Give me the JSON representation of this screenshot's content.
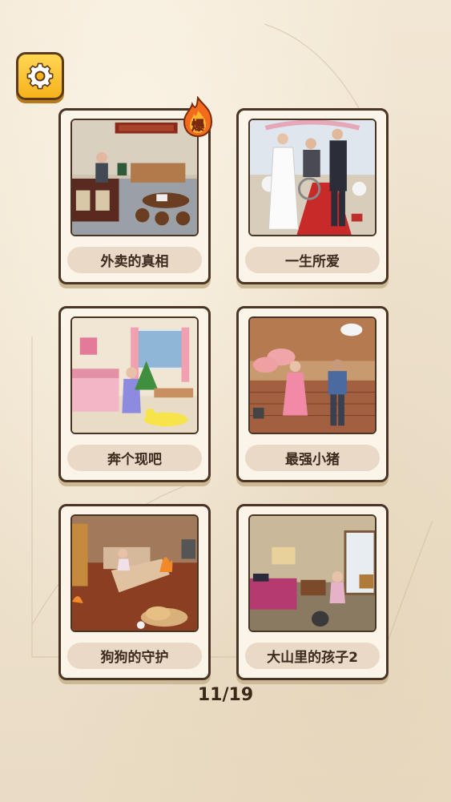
{
  "levels": [
    {
      "title": "外卖的真相",
      "badge": "爆"
    },
    {
      "title": "一生所爱"
    },
    {
      "title": "奔个现吧"
    },
    {
      "title": "最强小猪"
    },
    {
      "title": "狗狗的守护"
    },
    {
      "title": "大山里的孩子2"
    }
  ],
  "pager": {
    "text": "11/19"
  },
  "icons": {
    "settings": "gear-icon",
    "badge": "fire-icon"
  },
  "colors": {
    "card_border": "#4a3424",
    "label_bg": "#ead9c6",
    "settings_bg": "#f7b21c"
  }
}
